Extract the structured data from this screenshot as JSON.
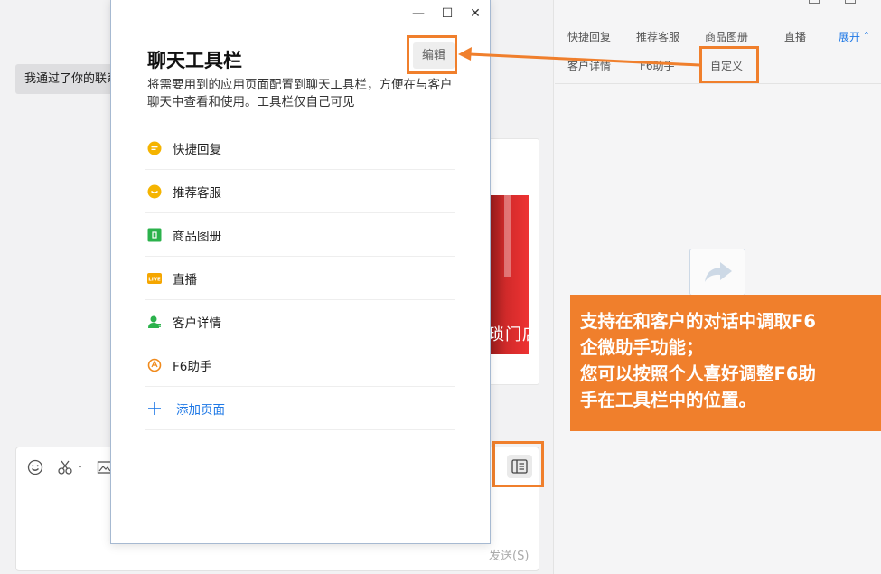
{
  "chat": {
    "message": "我通过了你的联系人验证请求",
    "card_image_text": "琐门店",
    "send_label": "发送(S)"
  },
  "right_panel": {
    "tabs": [
      "快捷回复",
      "推荐客服",
      "商品图册",
      "直播",
      "客户详情",
      "F6助手",
      "自定义"
    ],
    "expand": "展开"
  },
  "dialog": {
    "title": "聊天工具栏",
    "description": "将需要用到的应用页面配置到聊天工具栏，方便在与客户聊天中查看和使用。工具栏仅自己可见",
    "edit_label": "编辑",
    "items": [
      {
        "label": "快捷回复",
        "icon": "quick-reply-icon",
        "color": "#f5b400"
      },
      {
        "label": "推荐客服",
        "icon": "recommend-service-icon",
        "color": "#f5b400"
      },
      {
        "label": "商品图册",
        "icon": "product-album-icon",
        "color": "#2bb24c"
      },
      {
        "label": "直播",
        "icon": "live-icon",
        "color": "#f5a600"
      },
      {
        "label": "客户详情",
        "icon": "customer-detail-icon",
        "color": "#2bb24c"
      },
      {
        "label": "F6助手",
        "icon": "f6-assistant-icon",
        "color": "#f08a1c"
      }
    ],
    "add_label": "添加页面"
  },
  "callout": {
    "lines": [
      "支持在和客户的对话中调取F6",
      "企微助手功能；",
      "您可以按照个人喜好调整F6助",
      "手在工具栏中的位置。"
    ]
  },
  "colors": {
    "accent": "#f07f2c",
    "link": "#1e78e6"
  }
}
